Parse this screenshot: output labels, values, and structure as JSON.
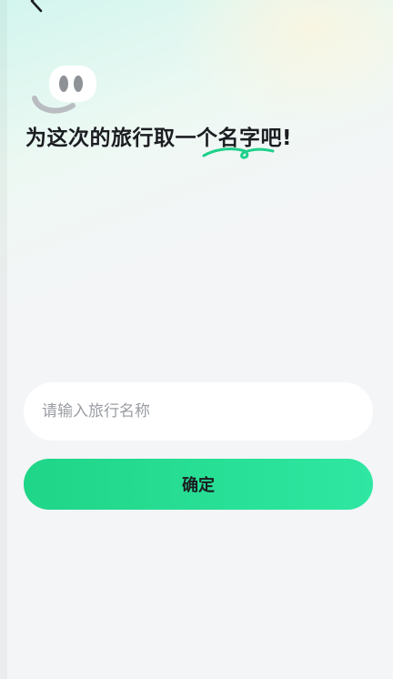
{
  "header": {
    "back_icon": "chevron-left-icon"
  },
  "mascot": {
    "icon": "smiley-mascot-icon"
  },
  "headline": {
    "prefix": "为这次的旅行取一个",
    "highlight": "名字",
    "suffix": "吧!"
  },
  "form": {
    "name_input": {
      "value": "",
      "placeholder": "请输入旅行名称"
    },
    "confirm_label": "确定"
  },
  "colors": {
    "accent_green": "#22d88c",
    "underline_green": "#1fd08a",
    "input_background": "#ffffff",
    "page_background": "#f4f5f7"
  }
}
